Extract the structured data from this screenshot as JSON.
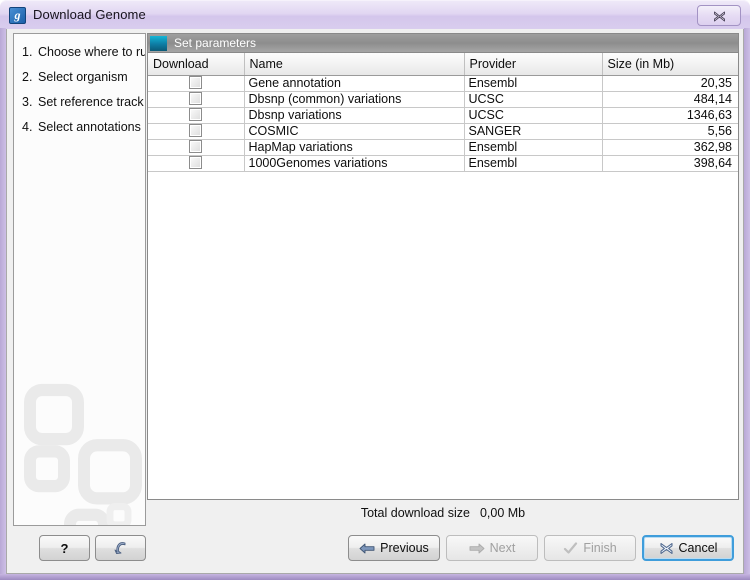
{
  "window": {
    "title": "Download Genome",
    "icon": "clc-workbench-icon",
    "icon_glyph": "g",
    "close_label": "X",
    "accent_purple": "#d4c6ec",
    "accent_teal": "#0e7ca3",
    "accent_blue": "#3f9ddb"
  },
  "sidebar": {
    "steps": [
      {
        "num": "1.",
        "label": "Choose where to run"
      },
      {
        "num": "2.",
        "label": "Select organism"
      },
      {
        "num": "3.",
        "label": "Set reference track"
      },
      {
        "num": "4.",
        "label": "Select annotations"
      }
    ]
  },
  "panel": {
    "title": "Set parameters",
    "icon": "panel-square-icon"
  },
  "table": {
    "columns": [
      "Download",
      "Name",
      "Provider",
      "Size (in Mb)"
    ],
    "rows": [
      {
        "download": false,
        "name": "Gene annotation",
        "provider": "Ensembl",
        "size": "20,35"
      },
      {
        "download": false,
        "name": "Dbsnp (common) variations",
        "provider": "UCSC",
        "size": "484,14"
      },
      {
        "download": false,
        "name": "Dbsnp variations",
        "provider": "UCSC",
        "size": "1346,63"
      },
      {
        "download": false,
        "name": "COSMIC",
        "provider": "SANGER",
        "size": "5,56"
      },
      {
        "download": false,
        "name": "HapMap variations",
        "provider": "Ensembl",
        "size": "362,98"
      },
      {
        "download": false,
        "name": "1000Genomes variations",
        "provider": "Ensembl",
        "size": "398,64"
      }
    ]
  },
  "status": {
    "label": "Total download size",
    "value": "0,00 Mb"
  },
  "buttons": {
    "help": {
      "label": "?",
      "icon": "question-mark-icon",
      "enabled": true
    },
    "reset": {
      "label": "",
      "icon": "reset-arrow-icon",
      "enabled": true
    },
    "previous": {
      "label": "Previous",
      "icon": "arrow-left-icon",
      "enabled": true
    },
    "next": {
      "label": "Next",
      "icon": "arrow-right-icon",
      "enabled": false
    },
    "finish": {
      "label": "Finish",
      "icon": "check-icon",
      "enabled": false
    },
    "cancel": {
      "label": "Cancel",
      "icon": "x-cross-icon",
      "enabled": true,
      "focused": true
    }
  }
}
